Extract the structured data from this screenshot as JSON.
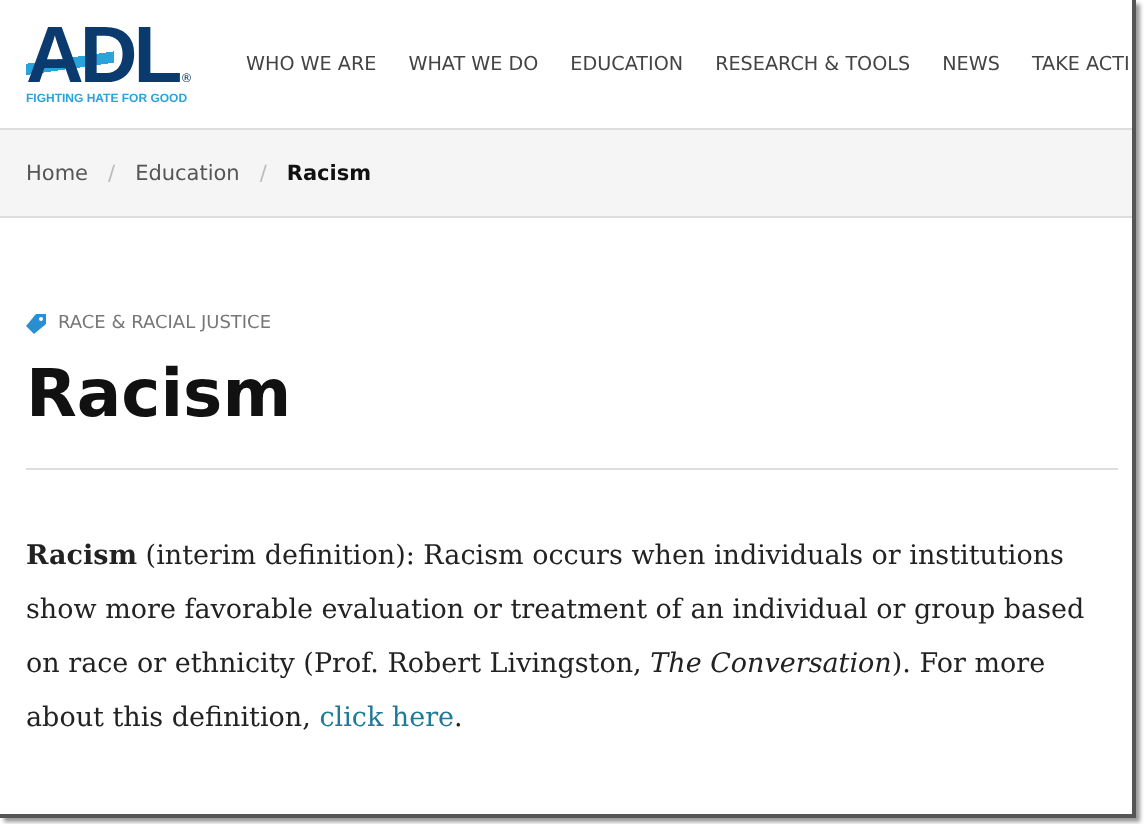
{
  "logo": {
    "wordmark": "ADL",
    "registered": "®",
    "tagline": "FIGHTING HATE FOR GOOD"
  },
  "nav": [
    "WHO WE ARE",
    "WHAT WE DO",
    "EDUCATION",
    "RESEARCH & TOOLS",
    "NEWS",
    "TAKE ACTI"
  ],
  "breadcrumb": [
    {
      "label": "Home",
      "current": false
    },
    {
      "label": "Education",
      "current": false
    },
    {
      "label": "Racism",
      "current": true
    }
  ],
  "separator": "/",
  "topic_tag": "RACE & RACIAL JUSTICE",
  "title": "Racism",
  "body": {
    "text": "**Racism** (interim definition): Racism occurs when individuals or institutions show more favorable evaluation or treatment of an individual or group based on race or ethnicity (Prof. Robert Livingston, *The Conversation*). For more about this definition,",
    "link": "click here",
    "after": "."
  }
}
